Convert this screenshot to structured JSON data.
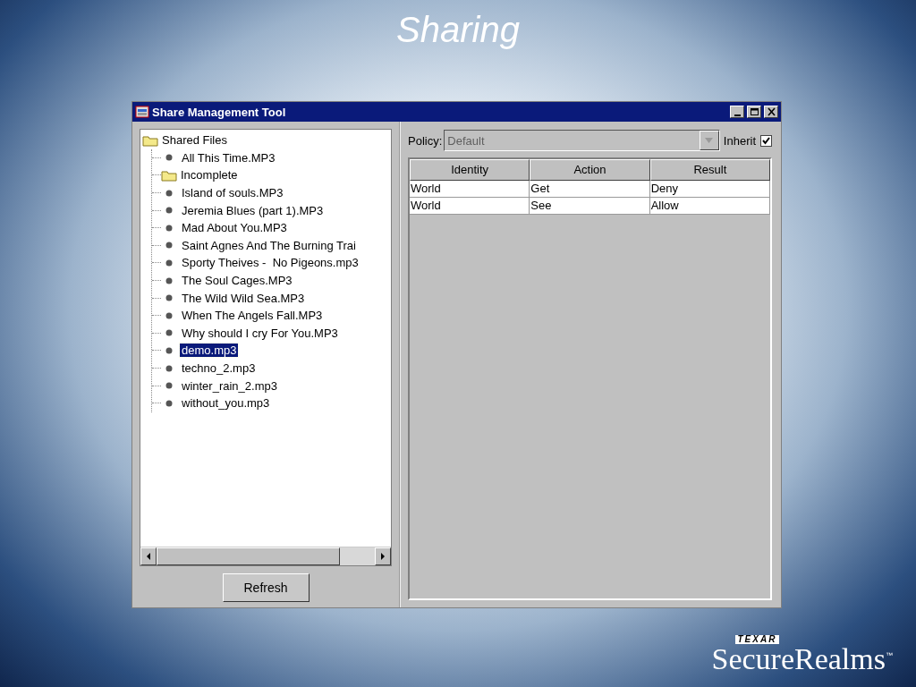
{
  "slide": {
    "title": "Sharing"
  },
  "window": {
    "title": "Share Management Tool"
  },
  "tree": {
    "label": "Shared Files",
    "kind": "folder",
    "selected": false,
    "children": [
      {
        "label": "All This Time.MP3",
        "kind": "file",
        "selected": false
      },
      {
        "label": "Incomplete",
        "kind": "folder",
        "selected": false
      },
      {
        "label": "Island of souls.MP3",
        "kind": "file",
        "selected": false
      },
      {
        "label": "Jeremia Blues (part 1).MP3",
        "kind": "file",
        "selected": false
      },
      {
        "label": "Mad About You.MP3",
        "kind": "file",
        "selected": false
      },
      {
        "label": "Saint Agnes And The Burning Trai",
        "kind": "file",
        "selected": false
      },
      {
        "label": "Sporty Theives -  No Pigeons.mp3",
        "kind": "file",
        "selected": false
      },
      {
        "label": "The Soul Cages.MP3",
        "kind": "file",
        "selected": false
      },
      {
        "label": "The Wild Wild Sea.MP3",
        "kind": "file",
        "selected": false
      },
      {
        "label": "When The Angels Fall.MP3",
        "kind": "file",
        "selected": false
      },
      {
        "label": "Why should I cry For You.MP3",
        "kind": "file",
        "selected": false
      },
      {
        "label": "demo.mp3",
        "kind": "file",
        "selected": true
      },
      {
        "label": "techno_2.mp3",
        "kind": "file",
        "selected": false
      },
      {
        "label": "winter_rain_2.mp3",
        "kind": "file",
        "selected": false
      },
      {
        "label": "without_you.mp3",
        "kind": "file",
        "selected": false
      }
    ]
  },
  "refresh_button": "Refresh",
  "policy": {
    "label": "Policy:",
    "value": "Default",
    "disabled": true
  },
  "inherit": {
    "label": "Inherit",
    "checked": true
  },
  "table": {
    "columns": [
      "Identity",
      "Action",
      "Result"
    ],
    "rows": [
      [
        "World",
        "Get",
        "Deny"
      ],
      [
        "World",
        "See",
        "Allow"
      ]
    ]
  },
  "logo": {
    "badge": "TEXAR",
    "name": "SecureRealms",
    "mark": "™"
  }
}
